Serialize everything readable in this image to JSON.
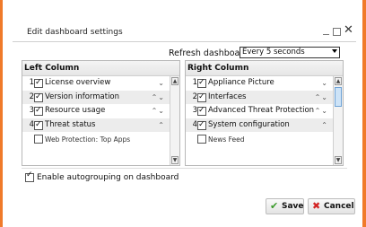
{
  "dialog": {
    "title": "Edit dashboard settings",
    "refresh_label": "Refresh dashboard",
    "refresh_value": "Every 5 seconds"
  },
  "left_column": {
    "header": "Left Column",
    "rows": [
      {
        "num": "1",
        "label": "License overview",
        "checked": true,
        "controls": "⌄"
      },
      {
        "num": "2",
        "label": "Version information",
        "checked": true,
        "controls": "⌃⌄"
      },
      {
        "num": "3",
        "label": "Resource usage",
        "checked": true,
        "controls": "⌃⌄"
      },
      {
        "num": "4",
        "label": "Threat status",
        "checked": true,
        "controls": "⌃"
      },
      {
        "num": "",
        "label": "Web Protection: Top Apps",
        "checked": false,
        "controls": ""
      }
    ]
  },
  "right_column": {
    "header": "Right Column",
    "rows": [
      {
        "num": "1",
        "label": "Appliance Picture",
        "checked": true,
        "controls": "⌄"
      },
      {
        "num": "2",
        "label": "Interfaces",
        "checked": true,
        "controls": "⌃⌄"
      },
      {
        "num": "3",
        "label": "Advanced Threat Protection",
        "checked": true,
        "controls": "⌃⌄"
      },
      {
        "num": "4",
        "label": "System configuration",
        "checked": true,
        "controls": "⌃"
      },
      {
        "num": "",
        "label": "News Feed",
        "checked": false,
        "controls": ""
      }
    ]
  },
  "autogroup": {
    "label": "Enable autogrouping on dashboard",
    "checked": true
  },
  "buttons": {
    "save": "Save",
    "cancel": "Cancel"
  },
  "colors": {
    "accent": "#f07a2a",
    "save_icon": "#3a9a2a",
    "cancel_icon": "#d32323"
  }
}
